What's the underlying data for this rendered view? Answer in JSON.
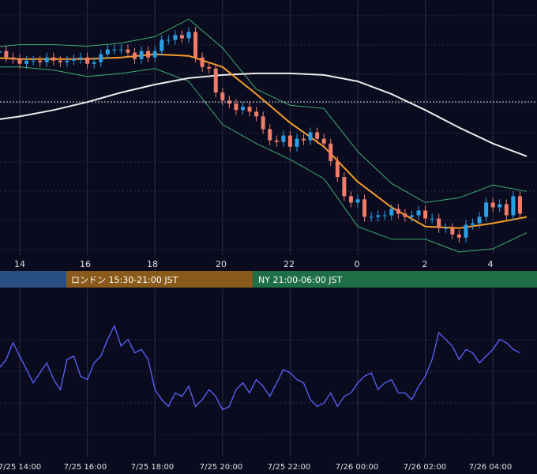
{
  "colors": {
    "background": "#0b0b1f",
    "grid": "#2a2f4a",
    "candle_up": "#2b9fe6",
    "candle_down": "#f07d68",
    "ma_orange": "#f39c2b",
    "ma_white": "#ececec",
    "bollinger": "#3cae70",
    "oscillator": "#5a63ff",
    "price_line": "#d8d8d8",
    "session_tokyo": "#2a4f82",
    "session_london": "#8a5a1a",
    "session_ny": "#1e6e46"
  },
  "top_axis": {
    "tick_labels": [
      "14",
      "16",
      "18",
      "20",
      "22",
      "0",
      "2",
      "4"
    ]
  },
  "sessions": [
    {
      "label": "",
      "color": "#2a4f82"
    },
    {
      "label": "ロンドン 15:30-21:00 JST",
      "color": "#8a5a1a"
    },
    {
      "label": "NY 21:00-06:00 JST",
      "color": "#1e6e46"
    }
  ],
  "bottom_axis": {
    "tick_labels": [
      "7/25 14:00",
      "7/25 16:00",
      "7/25 18:00",
      "7/25 20:00",
      "7/25 22:00",
      "7/26 00:00",
      "7/26 02:00",
      "7/26 04:00"
    ]
  },
  "chart_data": [
    {
      "type": "candlestick",
      "x": [
        13.0,
        13.2,
        13.4,
        13.6,
        13.8,
        14.0,
        14.2,
        14.4,
        14.6,
        14.8,
        15.0,
        15.2,
        15.4,
        15.6,
        15.8,
        16.0,
        16.2,
        16.4,
        16.6,
        16.8,
        17.0,
        17.2,
        17.4,
        17.6,
        17.8,
        18.0,
        18.2,
        18.4,
        18.6,
        18.8,
        19.0,
        19.2,
        19.4,
        19.6,
        19.8,
        20.0,
        20.2,
        20.4,
        20.6,
        20.8,
        21.0,
        21.2,
        21.4,
        21.6,
        21.8,
        22.0,
        22.2,
        22.4,
        22.6,
        22.8,
        23.0,
        23.2,
        23.4,
        23.6,
        23.8,
        24.0,
        24.2,
        24.4,
        24.6,
        24.8,
        25.0,
        25.2,
        25.4,
        25.6,
        25.8,
        26.0,
        26.2,
        26.4,
        26.6,
        26.8,
        27.0,
        27.2,
        27.4,
        27.6,
        27.8,
        28.0,
        28.2,
        28.4,
        28.6,
        28.8
      ],
      "close": [
        66,
        67,
        68,
        64,
        63,
        60,
        62,
        62,
        61,
        64,
        62,
        61,
        62,
        63,
        64,
        60,
        61,
        66,
        69,
        69,
        69,
        67,
        63,
        68,
        64,
        68,
        75,
        75,
        78,
        76,
        80,
        64,
        58,
        57,
        42,
        37,
        35,
        31,
        33,
        30,
        27,
        19,
        12,
        11,
        15,
        8,
        13,
        12,
        17,
        13,
        10,
        -1,
        -11,
        -23,
        -27,
        -25,
        -36,
        -36,
        -35,
        -35,
        -31,
        -34,
        -36,
        -35,
        -32,
        -37,
        -37,
        -43,
        -43,
        -47,
        -49,
        -41,
        -40,
        -36,
        -27,
        -30,
        -28,
        -35,
        -23,
        -34
      ],
      "ohlc_note": "close values in chart units (approx), read from candle bodies",
      "x_unit": "hours JST (24 = 7/26 00:00)"
    },
    {
      "type": "line",
      "name": "",
      "series": [
        {
          "x": [
            13.0,
            14.0,
            15.0,
            16.0,
            17.0,
            18.0,
            19.0,
            20.0,
            21.0,
            22.0,
            23.0,
            24.0,
            25.0,
            26.0,
            27.0,
            28.0,
            29.0
          ],
          "values": [
            64,
            63,
            63,
            63,
            64,
            66,
            65,
            58,
            41,
            23,
            8,
            -14,
            -30,
            -42,
            -43,
            -40,
            -36
          ]
        },
        {
          "x": [
            13.0,
            14.0,
            15.0,
            16.0,
            17.0,
            18.0,
            19.0,
            20.0,
            21.0,
            22.0,
            23.0,
            24.0,
            25.0,
            26.0,
            27.0,
            28.0,
            29.0
          ],
          "values": [
            24,
            27,
            31,
            36,
            42,
            47,
            51,
            53,
            54,
            54,
            53,
            49,
            41,
            31,
            20,
            10,
            2
          ]
        },
        {
          "x": [
            13.0,
            14.0,
            15.0,
            16.0,
            17.0,
            18.0,
            19.0,
            20.0,
            21.0,
            22.0,
            23.0,
            24.0,
            25.0,
            26.0,
            27.0,
            28.0,
            29.0
          ],
          "values": [
            70,
            72,
            72,
            71,
            73,
            77,
            88,
            70,
            44,
            34,
            32,
            5,
            -15,
            -27,
            -24,
            -16,
            -20
          ]
        },
        {
          "x": [
            13.0,
            14.0,
            15.0,
            16.0,
            17.0,
            18.0,
            19.0,
            20.0,
            21.0,
            22.0,
            23.0,
            24.0,
            25.0,
            26.0,
            27.0,
            28.0,
            29.0
          ],
          "values": [
            58,
            58,
            56,
            52,
            54,
            57,
            49,
            22,
            10,
            0,
            -12,
            -42,
            -50,
            -50,
            -58,
            -56,
            -46
          ]
        }
      ],
      "ylim": [
        -60,
        100
      ]
    },
    {
      "type": "line",
      "name": "",
      "x": [
        13.0,
        13.2,
        13.4,
        13.6,
        13.8,
        14.0,
        14.2,
        14.4,
        14.6,
        14.8,
        15.0,
        15.2,
        15.4,
        15.6,
        15.8,
        16.0,
        16.2,
        16.4,
        16.6,
        16.8,
        17.0,
        17.2,
        17.4,
        17.6,
        17.8,
        18.0,
        18.2,
        18.4,
        18.6,
        18.8,
        19.0,
        19.2,
        19.4,
        19.6,
        19.8,
        20.0,
        20.2,
        20.4,
        20.6,
        20.8,
        21.0,
        21.2,
        21.4,
        21.6,
        21.8,
        22.0,
        22.2,
        22.4,
        22.6,
        22.8,
        23.0,
        23.2,
        23.4,
        23.6,
        23.8,
        24.0,
        24.2,
        24.4,
        24.6,
        24.8,
        25.0,
        25.2,
        25.4,
        25.6,
        25.8,
        26.0,
        26.2,
        26.4,
        26.6,
        26.8,
        27.0,
        27.2,
        27.4,
        27.6,
        27.8,
        28.0,
        28.2,
        28.4,
        28.6,
        28.8
      ],
      "values": [
        62,
        55,
        53,
        58,
        68,
        60,
        52,
        44,
        50,
        56,
        46,
        40,
        58,
        60,
        48,
        46,
        56,
        60,
        70,
        78,
        66,
        70,
        62,
        64,
        58,
        40,
        34,
        30,
        38,
        36,
        42,
        30,
        34,
        40,
        36,
        28,
        30,
        40,
        44,
        38,
        46,
        42,
        36,
        44,
        52,
        50,
        46,
        44,
        34,
        30,
        32,
        38,
        30,
        36,
        38,
        44,
        48,
        50,
        40,
        44,
        46,
        38,
        38,
        34,
        42,
        48,
        58,
        74,
        70,
        66,
        58,
        64,
        62,
        56,
        60,
        64,
        70,
        68,
        64,
        62
      ],
      "ylim": [
        0,
        100
      ]
    }
  ]
}
